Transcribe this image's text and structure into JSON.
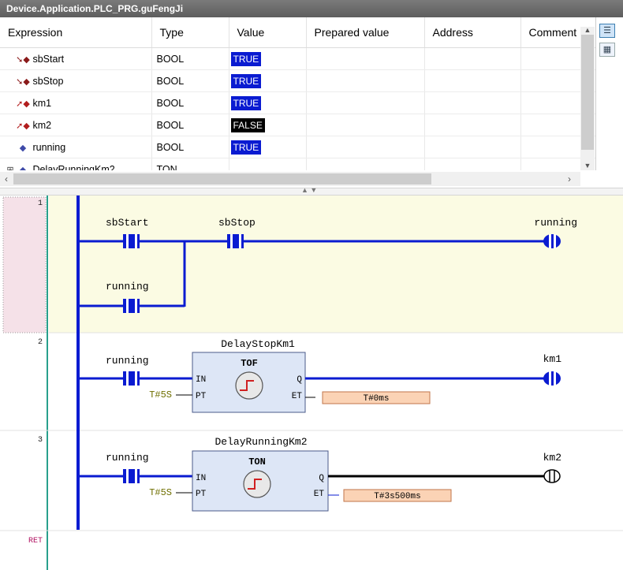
{
  "window": {
    "title": "Device.Application.PLC_PRG.guFengJi"
  },
  "watch": {
    "columns": [
      "Expression",
      "Type",
      "Value",
      "Prepared value",
      "Address",
      "Comment"
    ],
    "rows": [
      {
        "expression": "sbStart",
        "type": "BOOL",
        "value": "TRUE",
        "icon": "input-variable-icon"
      },
      {
        "expression": "sbStop",
        "type": "BOOL",
        "value": "TRUE",
        "icon": "input-variable-icon"
      },
      {
        "expression": "km1",
        "type": "BOOL",
        "value": "TRUE",
        "icon": "output-variable-icon"
      },
      {
        "expression": "km2",
        "type": "BOOL",
        "value": "FALSE",
        "icon": "output-variable-icon"
      },
      {
        "expression": "running",
        "type": "BOOL",
        "value": "TRUE",
        "icon": "variable-icon"
      },
      {
        "expression": "DelayRunningKm2",
        "type": "TON",
        "value": "",
        "icon": "variable-icon",
        "expandable": true
      }
    ]
  },
  "ladder": {
    "networks": [
      {
        "number": "1",
        "contacts": [
          "sbStart",
          "sbStop",
          "running"
        ],
        "coil": "running"
      },
      {
        "number": "2",
        "instance": "DelayStopKm1",
        "block_type": "TOF",
        "contact": "running",
        "pt": "T#5S",
        "et": "T#0ms",
        "coil": "km1",
        "in_pin": "IN",
        "pt_pin": "PT",
        "q_pin": "Q",
        "et_pin": "ET"
      },
      {
        "number": "3",
        "instance": "DelayRunningKm2",
        "block_type": "TON",
        "contact": "running",
        "pt": "T#5S",
        "et": "T#3s500ms",
        "coil": "km2",
        "in_pin": "IN",
        "pt_pin": "PT",
        "q_pin": "Q",
        "et_pin": "ET"
      }
    ],
    "ret_label": "RET"
  },
  "colors": {
    "energized": "#0a1bd1",
    "deenergized": "#000000",
    "selected_network_bg": "#fbfbe3",
    "selected_gutter_bg": "#f5e1e8",
    "fb_fill": "#dde6f6",
    "et_fill": "#fbd3b5",
    "pt_text": "#6f6f00"
  }
}
